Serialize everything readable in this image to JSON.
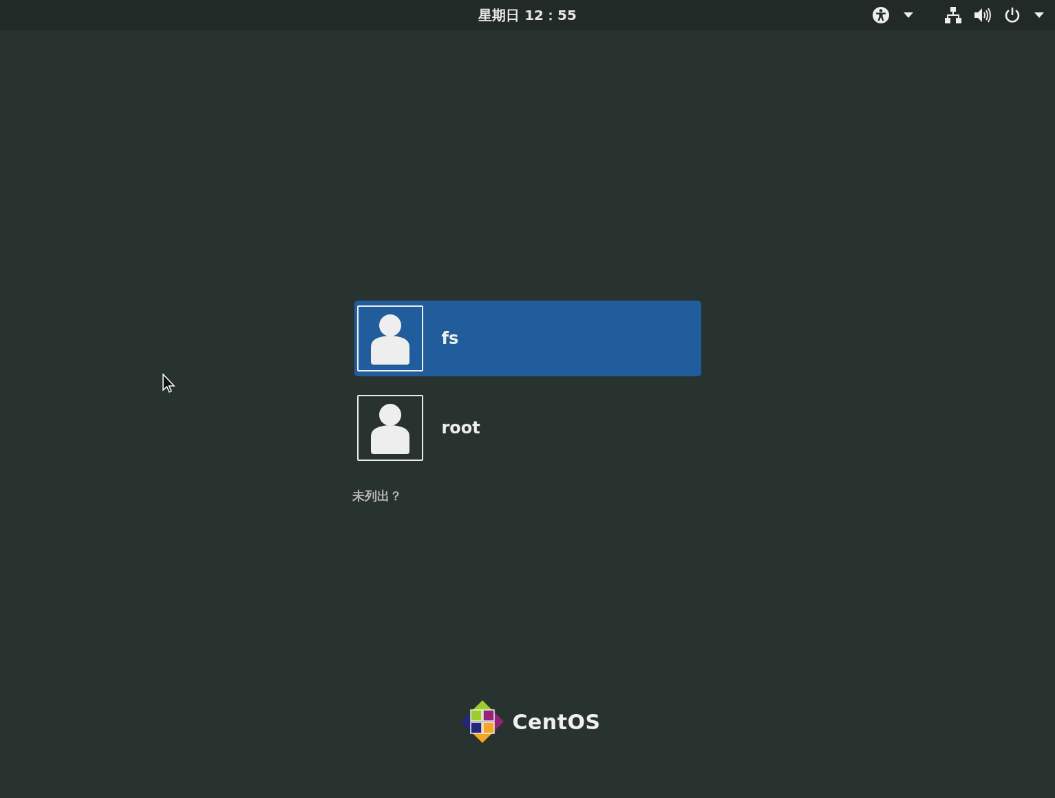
{
  "top_bar": {
    "clock": "星期日 12：55"
  },
  "users": [
    {
      "name": "fs",
      "selected": true
    },
    {
      "name": "root",
      "selected": false
    }
  ],
  "not_listed": "未列出？",
  "logo": {
    "text": "CentOS"
  }
}
